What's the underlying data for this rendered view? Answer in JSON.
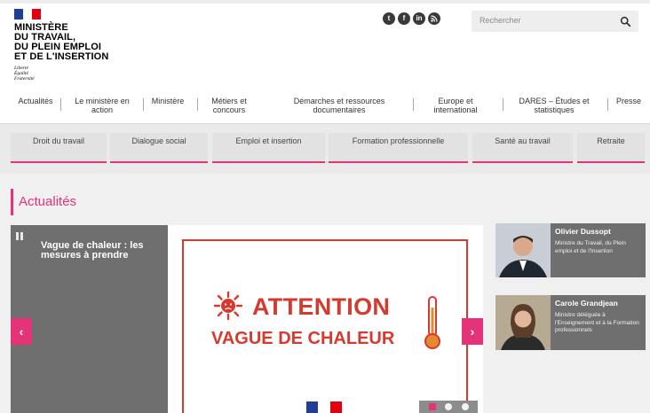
{
  "header": {
    "logo_lines": [
      "MINISTÈRE",
      "DU TRAVAIL,",
      "DU PLEIN EMPLOI",
      "ET DE L'INSERTION"
    ],
    "motto": [
      "Liberté",
      "Égalité",
      "Fraternité"
    ],
    "social_icons": [
      "twitter-icon",
      "facebook-icon",
      "linkedin-icon",
      "rss-icon"
    ],
    "search": {
      "placeholder": "Rechercher"
    }
  },
  "main_nav": [
    "Actualités",
    "Le ministère en action",
    "Ministère",
    "Métiers et concours",
    "Démarches et ressources documentaires",
    "Europe et international",
    "DARES – Études et statistiques",
    "Presse"
  ],
  "sub_nav": [
    "Droit du travail",
    "Dialogue social",
    "Emploi et insertion",
    "Formation professionnelle",
    "Santé au travail",
    "Retraite"
  ],
  "section": {
    "title": "Actualités"
  },
  "carousel": {
    "slide_title": "Vague de chaleur : les mesures à prendre",
    "banner_line1": "ATTENTION",
    "banner_line2": "VAGUE DE CHALEUR",
    "prev_label": "‹",
    "next_label": "›",
    "slide_count": 3,
    "active_slide": 1
  },
  "ministers": [
    {
      "name": "Olivier Dussopt",
      "role": "Ministre du Travail, du Plein emploi et de l'Insertion"
    },
    {
      "name": "Carole Grandjean",
      "role": "Ministre déléguée à l'Enseignement et à la Formation professionnels"
    }
  ],
  "colors": {
    "accent": "#e5337a",
    "alert": "#d63a2f",
    "panel": "#6f6f6f"
  }
}
